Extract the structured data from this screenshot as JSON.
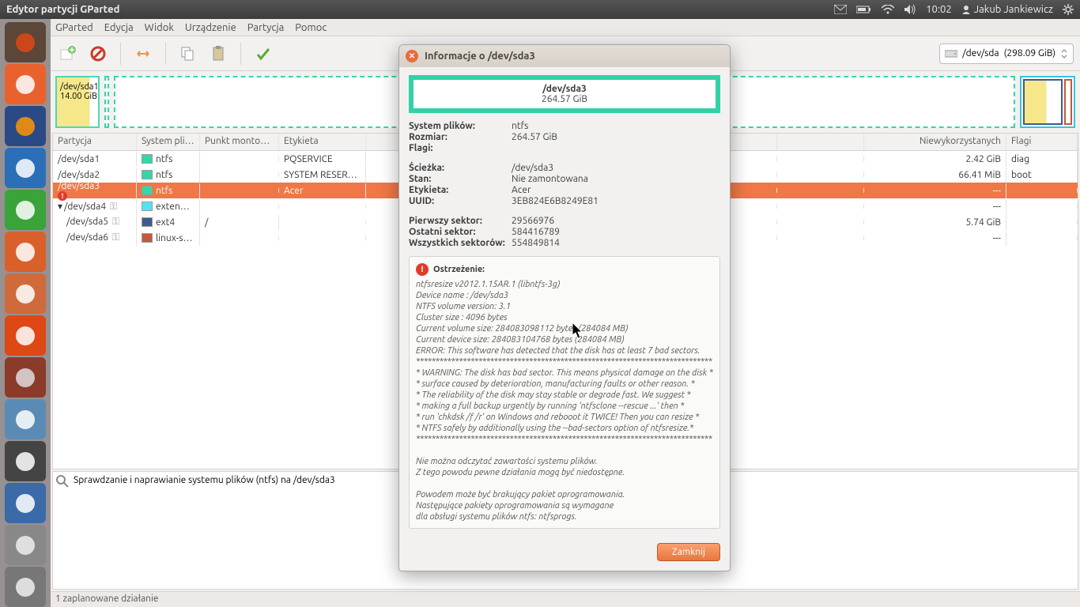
{
  "panel": {
    "title": "Edytor partycji GParted",
    "time": "10:02",
    "user": "Jakub Jankiewicz"
  },
  "menu": [
    "GParted",
    "Edycja",
    "Widok",
    "Urządzenie",
    "Partycja",
    "Pomoc"
  ],
  "disk_selector": {
    "device": "/dev/sda",
    "size": "(298.09 GiB)"
  },
  "partition_bar": [
    {
      "label": "/dev/sda1",
      "size": "14.00 GiB"
    }
  ],
  "table": {
    "headers": [
      "Partycja",
      "System plików",
      "Punkt montowania",
      "Etykieta",
      "",
      "",
      "Niewykorzystanych",
      "Flagi"
    ],
    "rows": [
      {
        "part": "/dev/sda1",
        "fs": "ntfs",
        "fs_color": "#35d6a6",
        "mp": "",
        "label": "PQSERVICE",
        "used": "",
        "unused": "2.42 GiB",
        "flags": "diag",
        "icon": ""
      },
      {
        "part": "/dev/sda2",
        "fs": "ntfs",
        "fs_color": "#35d6a6",
        "mp": "",
        "label": "SYSTEM RESERVED",
        "used": "",
        "unused": "66.41 MiB",
        "flags": "boot",
        "icon": ""
      },
      {
        "part": "/dev/sda3",
        "fs": "ntfs",
        "fs_color": "#35d6a6",
        "mp": "",
        "label": "Acer",
        "used": "",
        "unused": "---",
        "flags": "",
        "icon": "warn",
        "selected": true
      },
      {
        "part": "/dev/sda4",
        "fs": "extended",
        "fs_color": "#52e4f5",
        "mp": "",
        "label": "",
        "used": "",
        "unused": "---",
        "flags": "",
        "icon": "key",
        "expand": true
      },
      {
        "part": "/dev/sda5",
        "fs": "ext4",
        "fs_color": "#3f5b8c",
        "mp": "/",
        "label": "",
        "used": "",
        "unused": "5.74 GiB",
        "flags": "",
        "icon": "key",
        "indent": true
      },
      {
        "part": "/dev/sda6",
        "fs": "linux-swap",
        "fs_color": "#c05a3a",
        "mp": "",
        "label": "",
        "used": "",
        "unused": "---",
        "flags": "",
        "icon": "key",
        "indent": true
      }
    ]
  },
  "log": "Sprawdzanie i naprawianie systemu plików (ntfs) na /dev/sda3",
  "status": "1 zaplanowane działanie",
  "dialog": {
    "title": "Informacje o /dev/sda3",
    "bar": {
      "name": "/dev/sda3",
      "size": "264.57 GiB"
    },
    "kv1": [
      {
        "k": "System plików:",
        "v": "ntfs"
      },
      {
        "k": "Rozmiar:",
        "v": "264.57 GiB"
      },
      {
        "k": "Flagi:",
        "v": ""
      }
    ],
    "kv2": [
      {
        "k": "Ścieżka:",
        "v": "/dev/sda3"
      },
      {
        "k": "Stan:",
        "v": "Nie zamontowana"
      },
      {
        "k": "Etykieta:",
        "v": "Acer"
      },
      {
        "k": "UUID:",
        "v": "3EB824E6B8249E81"
      }
    ],
    "kv3": [
      {
        "k": "Pierwszy sektor:",
        "v": "29566976"
      },
      {
        "k": "Ostatni sektor:",
        "v": "584416789"
      },
      {
        "k": "Wszystkich sektorów:",
        "v": "554849814"
      }
    ],
    "warning_title": "Ostrzeżenie:",
    "warning_lines": [
      "ntfsresize v2012.1.15AR.1 (libntfs-3g)",
      "Device name       : /dev/sda3",
      "NTFS volume version: 3.1",
      "Cluster size       : 4096 bytes",
      "Current volume size: 284083098112 bytes (284084 MB)",
      "Current device size: 284083104768 bytes (284084 MB)",
      "ERROR: This software has detected that the disk has at least 7 bad sectors.",
      "****************************************************************************",
      "* WARNING: The disk has bad sector. This means physical damage on the disk *",
      "* surface caused by deterioration, manufacturing faults or other reason.    *",
      "* The reliability of the disk may stay stable or degrade fast. We suggest   *",
      "* making a full backup urgently by running 'ntfsclone --rescue ...' then    *",
      "* run 'chkdsk /f /r' on Windows and rebooot it TWICE! Then you can resize   *",
      "* NTFS safely by additionally using the --bad-sectors option of ntfsresize.*",
      "****************************************************************************",
      "",
      "Nie można odczytać zawartości systemu plików.",
      "Z tego powodu pewne działania mogą być niedostępne.",
      "",
      "Powodem może być brakujący pakiet oprogramowania.",
      "Następujące pakiety oprogramowania są wymagane",
      "dla obsługi systemu plików ntfs: ntfsprogs."
    ],
    "close_button": "Zamknij"
  },
  "launcher_apps": [
    {
      "name": "ubuntu",
      "color": "#5b4637",
      "fg": "#dd4814"
    },
    {
      "name": "files",
      "color": "#e9622e",
      "fg": "#fff"
    },
    {
      "name": "firefox",
      "color": "#2b4a85",
      "fg": "#ff9500"
    },
    {
      "name": "writer",
      "color": "#2a6fb8",
      "fg": "#fff"
    },
    {
      "name": "calc",
      "color": "#3aa33a",
      "fg": "#fff"
    },
    {
      "name": "impress",
      "color": "#d9602a",
      "fg": "#fff"
    },
    {
      "name": "software",
      "color": "#d16a3a",
      "fg": "#fff"
    },
    {
      "name": "ubuntu-one",
      "color": "#dd4814",
      "fg": "#fff"
    },
    {
      "name": "settings",
      "color": "#8a3b2a",
      "fg": "#ddd"
    },
    {
      "name": "chromium",
      "color": "#5a8bb5",
      "fg": "#fff"
    },
    {
      "name": "colors",
      "color": "#444",
      "fg": "#fff"
    },
    {
      "name": "photos",
      "color": "#3a6aa8",
      "fg": "#fff"
    },
    {
      "name": "cd",
      "color": "#888",
      "fg": "#eee"
    },
    {
      "name": "dvd",
      "color": "#777",
      "fg": "#eee"
    }
  ]
}
